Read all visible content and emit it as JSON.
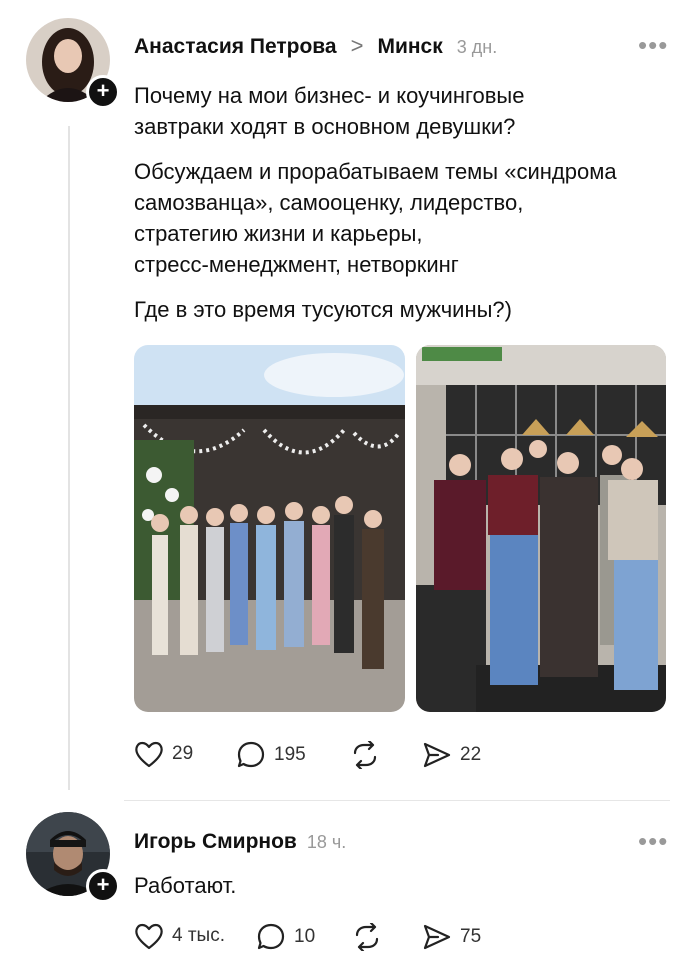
{
  "post": {
    "author": "Анастасия Петрова",
    "separator": ">",
    "community": "Минск",
    "time": "3 дн.",
    "more": "•••",
    "paragraphs": [
      "Почему на мои бизнес- и коучинговые\nзавтраки ходят в основном девушки?",
      "Обсуждаем и прорабатываем темы «синдрома\nсамозванца», самооценку, лидерство,\nстратегию жизни и карьеры,\nстресс-менеджмент, нетворкинг",
      "Где в это время тусуются мужчины?)"
    ],
    "likes": "29",
    "comments": "195",
    "shares": "22"
  },
  "reply": {
    "author": "Игорь Смирнов",
    "time": "18 ч.",
    "more": "•••",
    "text": "Работают.",
    "likes": "4 тыс.",
    "comments": "10",
    "shares": "75"
  },
  "icons": {
    "follow": "plus-icon",
    "like": "heart-icon",
    "comment": "comment-bubble-icon",
    "repost": "repost-arrows-icon",
    "share": "send-arrow-icon",
    "more": "more-dots-icon"
  }
}
